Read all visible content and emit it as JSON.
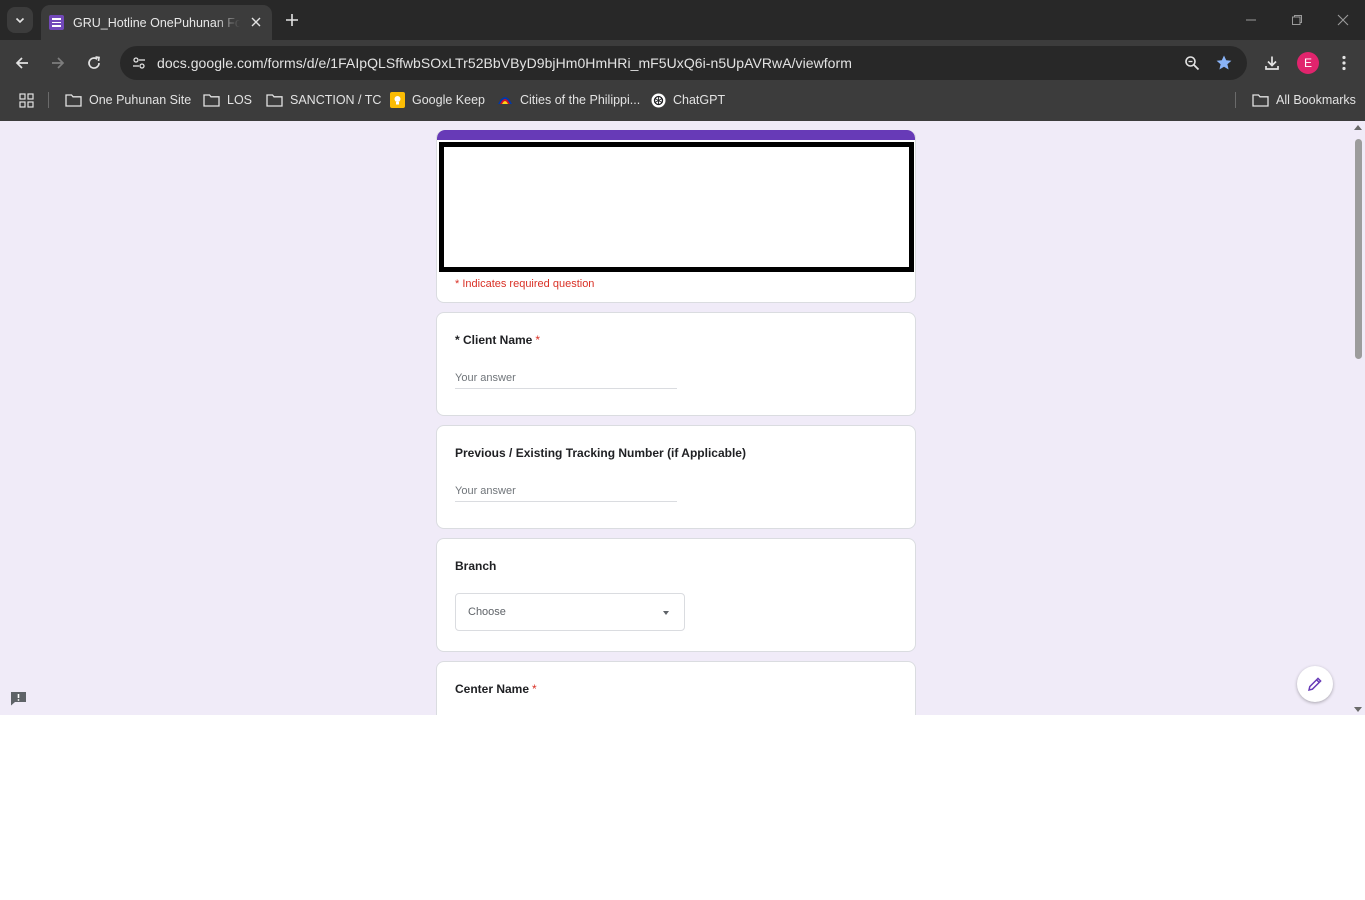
{
  "browser": {
    "tab": {
      "title": "GRU_Hotline OnePuhunan Form",
      "favicon": "google-forms-icon"
    },
    "url": "docs.google.com/forms/d/e/1FAIpQLSffwbSOxLTr52BbVByD9bjHm0HmHRi_mF5UxQ6i-n5UpAVRwA/viewform",
    "avatar_initial": "E",
    "avatar_color": "#e1246d",
    "bookmarks": [
      {
        "label": "One Puhunan Site",
        "icon": "folder-icon"
      },
      {
        "label": "LOS",
        "icon": "folder-icon"
      },
      {
        "label": "SANCTION / TC",
        "icon": "folder-icon"
      },
      {
        "label": "Google Keep",
        "icon": "google-keep-icon"
      },
      {
        "label": "Cities of the Philippi...",
        "icon": "philippines-flag-icon"
      },
      {
        "label": "ChatGPT",
        "icon": "chatgpt-icon"
      }
    ],
    "all_bookmarks_label": "All Bookmarks"
  },
  "form": {
    "accent_color": "#673ab7",
    "background_color": "#f0ebf8",
    "required_note": "* Indicates required question",
    "questions": [
      {
        "title": "* Client Name",
        "required_mark": "*",
        "type": "short_answer",
        "placeholder": "Your answer"
      },
      {
        "title": "Previous / Existing Tracking Number (if Applicable)",
        "required_mark": "",
        "type": "short_answer",
        "placeholder": "Your answer"
      },
      {
        "title": "Branch",
        "required_mark": "",
        "type": "dropdown",
        "selected": "Choose"
      },
      {
        "title": "Center Name",
        "required_mark": "*",
        "type": "short_answer"
      }
    ]
  }
}
